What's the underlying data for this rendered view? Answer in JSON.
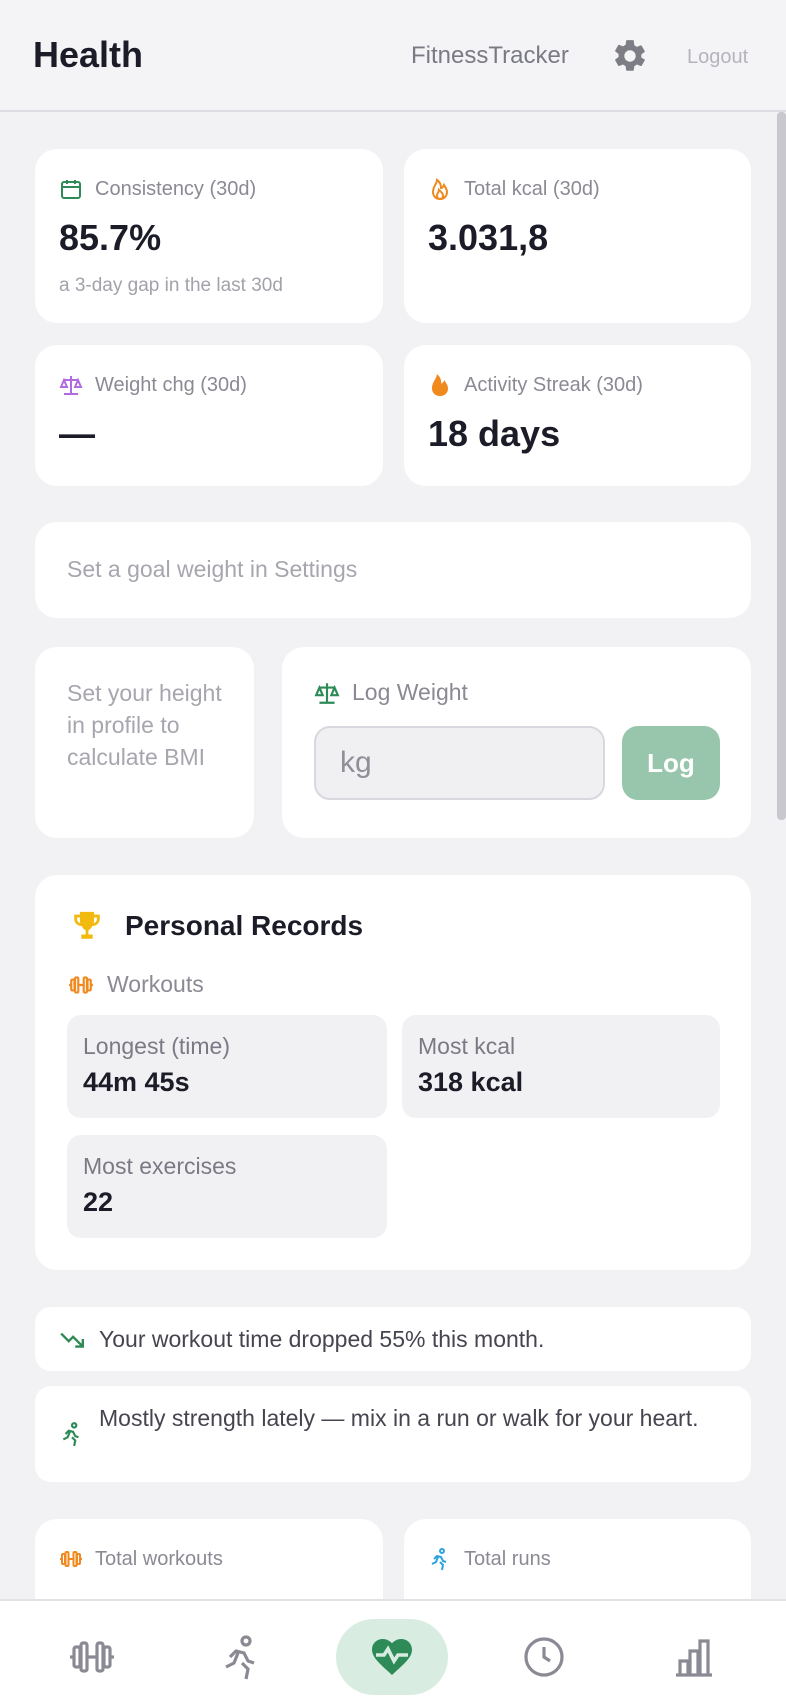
{
  "header": {
    "title": "Health",
    "brand": "FitnessTracker",
    "logout": "Logout",
    "settings_icon": "gear-icon"
  },
  "stats": {
    "consistency": {
      "label": "Consistency (30d)",
      "value": "85.7%",
      "sub": "a 3-day gap in the last 30d",
      "icon": "calendar-icon"
    },
    "kcal": {
      "label": "Total kcal (30d)",
      "value": "3.031,8",
      "icon": "flame-icon"
    },
    "weight": {
      "label": "Weight chg (30d)",
      "value": "—",
      "icon": "scale-icon"
    },
    "streak": {
      "label": "Activity Streak (30d)",
      "value": "18 days",
      "icon": "fire-icon"
    }
  },
  "goal": {
    "text": "Set a goal weight in Settings"
  },
  "bmi": {
    "text": "Set your height in profile to calculate BMI"
  },
  "log_weight": {
    "label": "Log Weight",
    "placeholder": "kg",
    "button": "Log"
  },
  "records": {
    "title": "Personal Records",
    "category": "Workouts",
    "items": [
      {
        "label": "Longest (time)",
        "value": "44m 45s"
      },
      {
        "label": "Most kcal",
        "value": "318 kcal"
      },
      {
        "label": "Most exercises",
        "value": "22"
      }
    ]
  },
  "insights": [
    {
      "text": "Your workout time dropped 55% this month.",
      "icon": "trending-down-icon"
    },
    {
      "text": "Mostly strength lately — mix in a run or walk for your heart.",
      "icon": "runner-icon"
    }
  ],
  "totals": {
    "workouts": {
      "label": "Total workouts"
    },
    "runs": {
      "label": "Total runs"
    }
  },
  "nav": [
    {
      "name": "workouts",
      "icon": "dumbbell-icon"
    },
    {
      "name": "runs",
      "icon": "runner-icon"
    },
    {
      "name": "health",
      "icon": "heart-pulse-icon",
      "active": true
    },
    {
      "name": "history",
      "icon": "clock-icon"
    },
    {
      "name": "stats",
      "icon": "bar-chart-icon"
    }
  ],
  "colors": {
    "accent": "#2e8b57",
    "accent_soft": "#98c6ac",
    "orange": "#f0891e",
    "purple": "#b06be0",
    "sky": "#2fa3e0",
    "gold": "#f2b90f"
  }
}
